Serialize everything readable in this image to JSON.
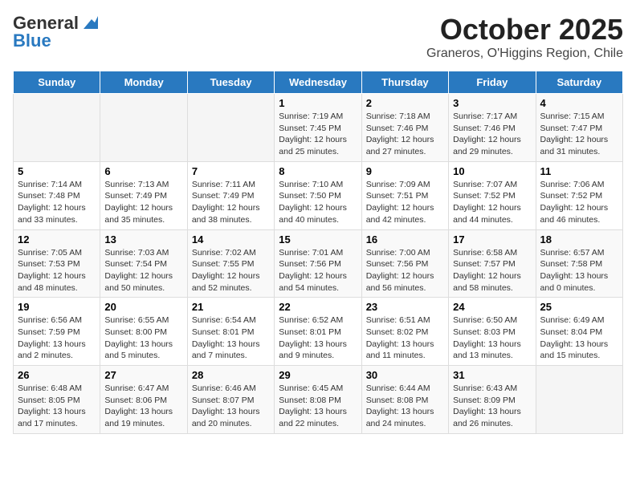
{
  "header": {
    "logo_general": "General",
    "logo_blue": "Blue",
    "month": "October 2025",
    "location": "Graneros, O'Higgins Region, Chile"
  },
  "days_of_week": [
    "Sunday",
    "Monday",
    "Tuesday",
    "Wednesday",
    "Thursday",
    "Friday",
    "Saturday"
  ],
  "weeks": [
    [
      {
        "day": "",
        "info": ""
      },
      {
        "day": "",
        "info": ""
      },
      {
        "day": "",
        "info": ""
      },
      {
        "day": "1",
        "info": "Sunrise: 7:19 AM\nSunset: 7:45 PM\nDaylight: 12 hours\nand 25 minutes."
      },
      {
        "day": "2",
        "info": "Sunrise: 7:18 AM\nSunset: 7:46 PM\nDaylight: 12 hours\nand 27 minutes."
      },
      {
        "day": "3",
        "info": "Sunrise: 7:17 AM\nSunset: 7:46 PM\nDaylight: 12 hours\nand 29 minutes."
      },
      {
        "day": "4",
        "info": "Sunrise: 7:15 AM\nSunset: 7:47 PM\nDaylight: 12 hours\nand 31 minutes."
      }
    ],
    [
      {
        "day": "5",
        "info": "Sunrise: 7:14 AM\nSunset: 7:48 PM\nDaylight: 12 hours\nand 33 minutes."
      },
      {
        "day": "6",
        "info": "Sunrise: 7:13 AM\nSunset: 7:49 PM\nDaylight: 12 hours\nand 35 minutes."
      },
      {
        "day": "7",
        "info": "Sunrise: 7:11 AM\nSunset: 7:49 PM\nDaylight: 12 hours\nand 38 minutes."
      },
      {
        "day": "8",
        "info": "Sunrise: 7:10 AM\nSunset: 7:50 PM\nDaylight: 12 hours\nand 40 minutes."
      },
      {
        "day": "9",
        "info": "Sunrise: 7:09 AM\nSunset: 7:51 PM\nDaylight: 12 hours\nand 42 minutes."
      },
      {
        "day": "10",
        "info": "Sunrise: 7:07 AM\nSunset: 7:52 PM\nDaylight: 12 hours\nand 44 minutes."
      },
      {
        "day": "11",
        "info": "Sunrise: 7:06 AM\nSunset: 7:52 PM\nDaylight: 12 hours\nand 46 minutes."
      }
    ],
    [
      {
        "day": "12",
        "info": "Sunrise: 7:05 AM\nSunset: 7:53 PM\nDaylight: 12 hours\nand 48 minutes."
      },
      {
        "day": "13",
        "info": "Sunrise: 7:03 AM\nSunset: 7:54 PM\nDaylight: 12 hours\nand 50 minutes."
      },
      {
        "day": "14",
        "info": "Sunrise: 7:02 AM\nSunset: 7:55 PM\nDaylight: 12 hours\nand 52 minutes."
      },
      {
        "day": "15",
        "info": "Sunrise: 7:01 AM\nSunset: 7:56 PM\nDaylight: 12 hours\nand 54 minutes."
      },
      {
        "day": "16",
        "info": "Sunrise: 7:00 AM\nSunset: 7:56 PM\nDaylight: 12 hours\nand 56 minutes."
      },
      {
        "day": "17",
        "info": "Sunrise: 6:58 AM\nSunset: 7:57 PM\nDaylight: 12 hours\nand 58 minutes."
      },
      {
        "day": "18",
        "info": "Sunrise: 6:57 AM\nSunset: 7:58 PM\nDaylight: 13 hours\nand 0 minutes."
      }
    ],
    [
      {
        "day": "19",
        "info": "Sunrise: 6:56 AM\nSunset: 7:59 PM\nDaylight: 13 hours\nand 2 minutes."
      },
      {
        "day": "20",
        "info": "Sunrise: 6:55 AM\nSunset: 8:00 PM\nDaylight: 13 hours\nand 5 minutes."
      },
      {
        "day": "21",
        "info": "Sunrise: 6:54 AM\nSunset: 8:01 PM\nDaylight: 13 hours\nand 7 minutes."
      },
      {
        "day": "22",
        "info": "Sunrise: 6:52 AM\nSunset: 8:01 PM\nDaylight: 13 hours\nand 9 minutes."
      },
      {
        "day": "23",
        "info": "Sunrise: 6:51 AM\nSunset: 8:02 PM\nDaylight: 13 hours\nand 11 minutes."
      },
      {
        "day": "24",
        "info": "Sunrise: 6:50 AM\nSunset: 8:03 PM\nDaylight: 13 hours\nand 13 minutes."
      },
      {
        "day": "25",
        "info": "Sunrise: 6:49 AM\nSunset: 8:04 PM\nDaylight: 13 hours\nand 15 minutes."
      }
    ],
    [
      {
        "day": "26",
        "info": "Sunrise: 6:48 AM\nSunset: 8:05 PM\nDaylight: 13 hours\nand 17 minutes."
      },
      {
        "day": "27",
        "info": "Sunrise: 6:47 AM\nSunset: 8:06 PM\nDaylight: 13 hours\nand 19 minutes."
      },
      {
        "day": "28",
        "info": "Sunrise: 6:46 AM\nSunset: 8:07 PM\nDaylight: 13 hours\nand 20 minutes."
      },
      {
        "day": "29",
        "info": "Sunrise: 6:45 AM\nSunset: 8:08 PM\nDaylight: 13 hours\nand 22 minutes."
      },
      {
        "day": "30",
        "info": "Sunrise: 6:44 AM\nSunset: 8:08 PM\nDaylight: 13 hours\nand 24 minutes."
      },
      {
        "day": "31",
        "info": "Sunrise: 6:43 AM\nSunset: 8:09 PM\nDaylight: 13 hours\nand 26 minutes."
      },
      {
        "day": "",
        "info": ""
      }
    ]
  ]
}
